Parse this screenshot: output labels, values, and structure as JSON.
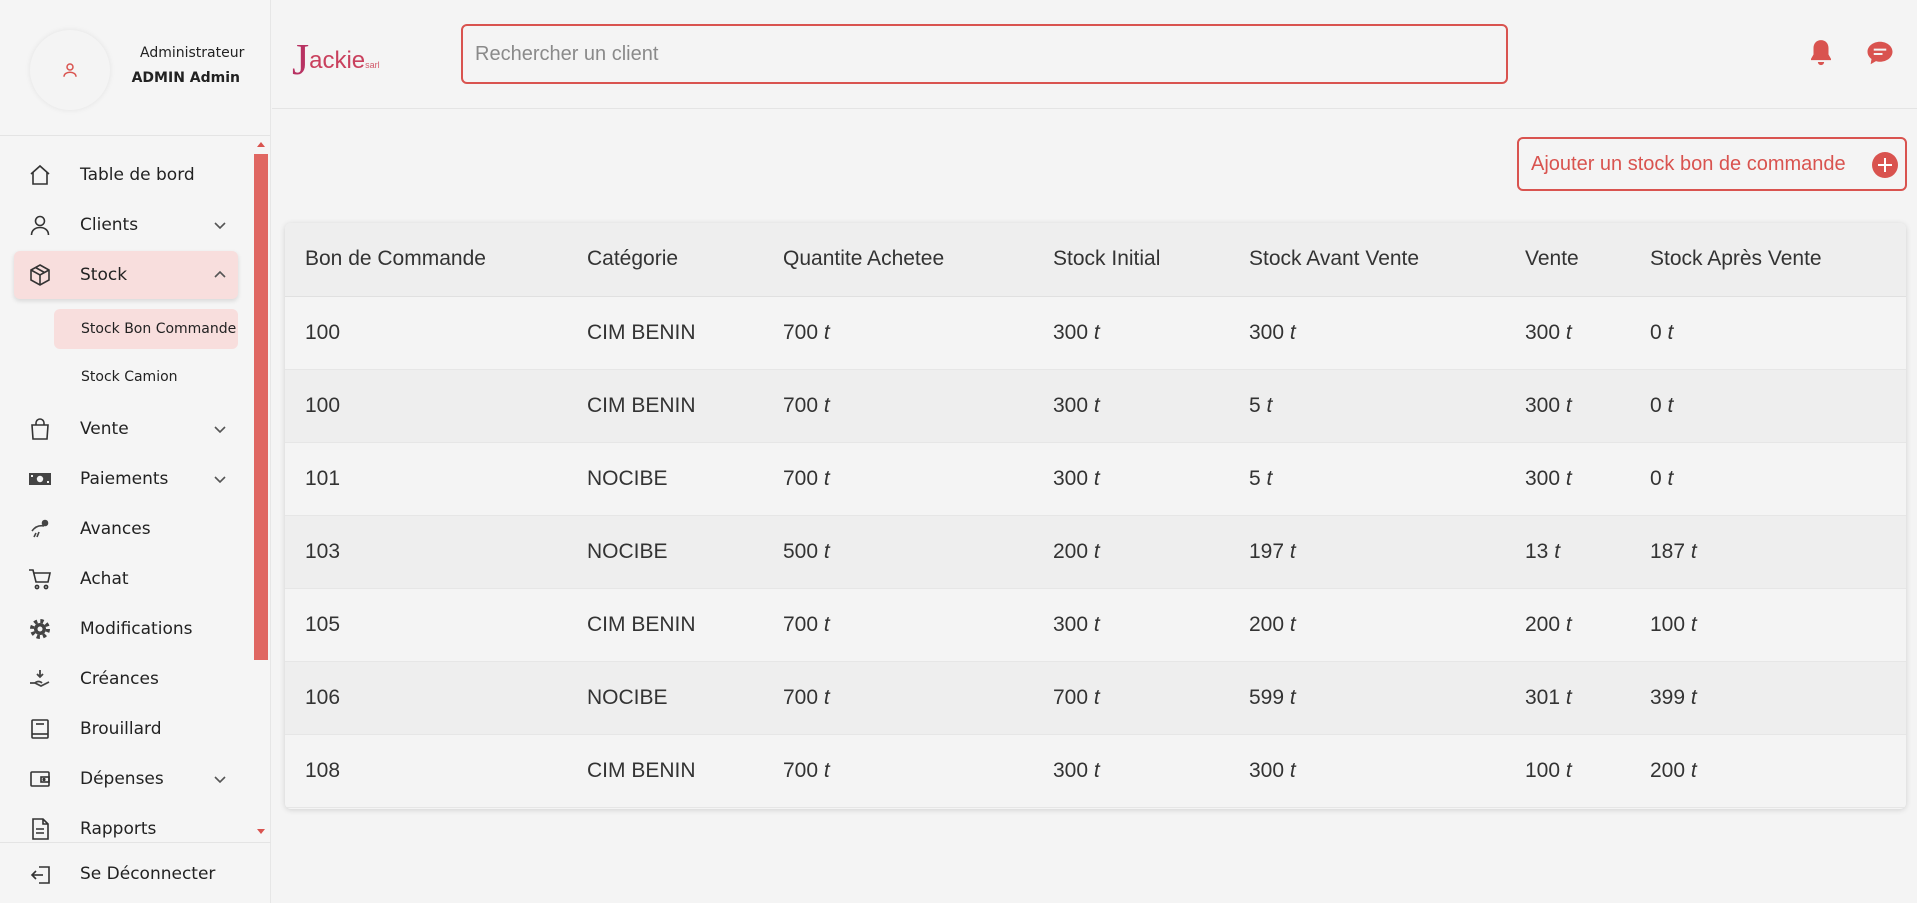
{
  "profile": {
    "role": "Administrateur",
    "name": "ADMIN Admin"
  },
  "logo": {
    "first": "J",
    "rest": "ackie",
    "suffix": "sarl"
  },
  "search": {
    "placeholder": "Rechercher un client",
    "value": ""
  },
  "menu": {
    "items": [
      {
        "label": "Table de bord"
      },
      {
        "label": "Clients"
      },
      {
        "label": "Stock"
      },
      {
        "label": "Vente"
      },
      {
        "label": "Paiements"
      },
      {
        "label": "Avances"
      },
      {
        "label": "Achat"
      },
      {
        "label": "Modifications"
      },
      {
        "label": "Créances"
      },
      {
        "label": "Brouillard"
      },
      {
        "label": "Dépenses"
      },
      {
        "label": "Rapports"
      }
    ],
    "sub": [
      {
        "label": "Stock Bon Commande"
      },
      {
        "label": "Stock Camion"
      }
    ],
    "logout": "Se Déconnecter"
  },
  "actions": {
    "add_label": "Ajouter un stock bon de commande"
  },
  "table": {
    "unit": "t",
    "headers": [
      "Bon de Commande",
      "Catégorie",
      "Quantite Achetee",
      "Stock Initial",
      "Stock Avant Vente",
      "Vente",
      "Stock Après Vente"
    ],
    "rows": [
      {
        "bon": "100",
        "categorie": "CIM BENIN",
        "quantite": "700",
        "initial": "300",
        "avant": "300",
        "vente": "300",
        "apres": "0"
      },
      {
        "bon": "100",
        "categorie": "CIM BENIN",
        "quantite": "700",
        "initial": "300",
        "avant": "5",
        "vente": "300",
        "apres": "0"
      },
      {
        "bon": "101",
        "categorie": "NOCIBE",
        "quantite": "700",
        "initial": "300",
        "avant": "5",
        "vente": "300",
        "apres": "0"
      },
      {
        "bon": "103",
        "categorie": "NOCIBE",
        "quantite": "500",
        "initial": "200",
        "avant": "197",
        "vente": "13",
        "apres": "187"
      },
      {
        "bon": "105",
        "categorie": "CIM BENIN",
        "quantite": "700",
        "initial": "300",
        "avant": "200",
        "vente": "200",
        "apres": "100"
      },
      {
        "bon": "106",
        "categorie": "NOCIBE",
        "quantite": "700",
        "initial": "700",
        "avant": "599",
        "vente": "301",
        "apres": "399"
      },
      {
        "bon": "108",
        "categorie": "CIM BENIN",
        "quantite": "700",
        "initial": "300",
        "avant": "300",
        "vente": "100",
        "apres": "200"
      }
    ]
  },
  "colors": {
    "accent": "#d9534f",
    "active_bg": "#f8dedd",
    "logo": "#c0395a"
  }
}
